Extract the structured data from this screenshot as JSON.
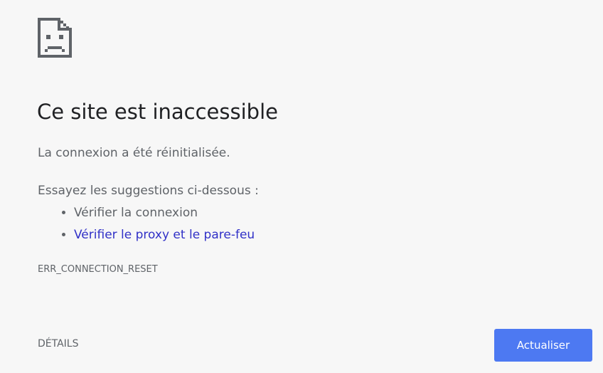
{
  "icon": "sad-page-icon",
  "title": "Ce site est inaccessible",
  "message": "La connexion a été réinitialisée.",
  "suggestions": {
    "heading": "Essayez les suggestions ci-dessous :",
    "items": [
      {
        "label": "Vérifier la connexion",
        "is_link": false
      },
      {
        "label": "Vérifier le proxy et le pare-feu",
        "is_link": true
      }
    ]
  },
  "error_code": "ERR_CONNECTION_RESET",
  "buttons": {
    "details": "DÉTAILS",
    "reload": "Actualiser"
  },
  "colors": {
    "background": "#f7f7f7",
    "link": "#3131c7",
    "primary_button": "#4d79f2"
  }
}
